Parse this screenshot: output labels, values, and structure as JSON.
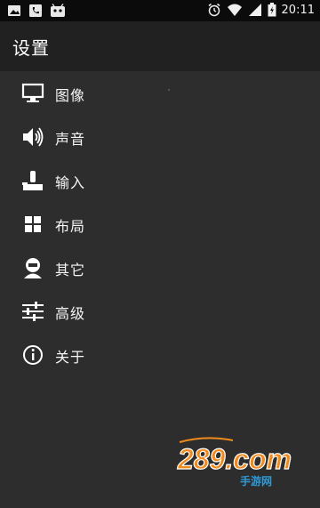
{
  "status_bar": {
    "time": "20:11",
    "icons": [
      "image-icon",
      "phone-icon",
      "android-icon",
      "alarm-icon",
      "wifi-icon",
      "signal-icon",
      "battery-icon"
    ]
  },
  "app_bar": {
    "title": "设置"
  },
  "menu": {
    "items": [
      {
        "label": "图像",
        "icon": "monitor-icon"
      },
      {
        "label": "声音",
        "icon": "speaker-icon"
      },
      {
        "label": "输入",
        "icon": "joystick-icon"
      },
      {
        "label": "布局",
        "icon": "grid-icon"
      },
      {
        "label": "其它",
        "icon": "person-icon"
      },
      {
        "label": "高级",
        "icon": "sliders-icon"
      },
      {
        "label": "关于",
        "icon": "info-icon"
      }
    ]
  },
  "watermark": {
    "brand": "289.com",
    "subtitle": "手游网"
  },
  "colors": {
    "background": "#2d2d2d",
    "app_bar": "#212121",
    "status_bar": "#0b0b0b",
    "text": "#f5f5f5",
    "watermark_orange": "#f08a1c",
    "watermark_blue": "#2f9ad6"
  }
}
